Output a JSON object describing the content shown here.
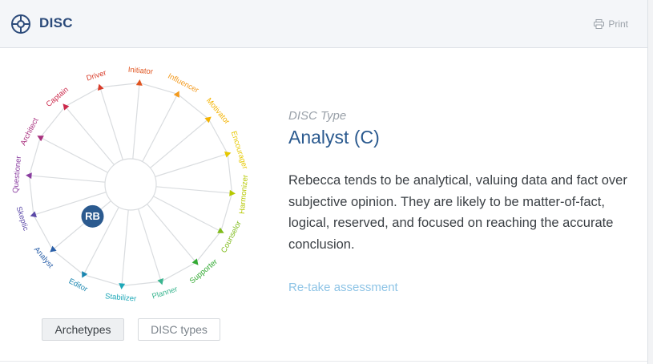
{
  "header": {
    "title": "DISC",
    "print_label": "Print",
    "title_icon": "crosshair-circle-icon",
    "print_icon": "printer-icon",
    "accent": "#2b4a7a"
  },
  "wheel": {
    "avatar_initials": "RB",
    "avatar_color": "#2b5a8f",
    "archetypes": [
      {
        "label": "Initiator",
        "color": "#e0541f"
      },
      {
        "label": "Influencer",
        "color": "#f39a1d"
      },
      {
        "label": "Motivator",
        "color": "#f4b300"
      },
      {
        "label": "Encourager",
        "color": "#e6c800"
      },
      {
        "label": "Harmonizer",
        "color": "#b6c800"
      },
      {
        "label": "Counselor",
        "color": "#7fbb1a"
      },
      {
        "label": "Supporter",
        "color": "#33aa33"
      },
      {
        "label": "Planner",
        "color": "#3ab58f"
      },
      {
        "label": "Stabilizer",
        "color": "#1ea8b8"
      },
      {
        "label": "Editor",
        "color": "#1a86b0"
      },
      {
        "label": "Analyst",
        "color": "#2a5fa8"
      },
      {
        "label": "Skeptic",
        "color": "#5c4aa8"
      },
      {
        "label": "Questioner",
        "color": "#8a3ea0"
      },
      {
        "label": "Architect",
        "color": "#a8307e"
      },
      {
        "label": "Captain",
        "color": "#cc2a4c"
      },
      {
        "label": "Driver",
        "color": "#d83c2a"
      }
    ]
  },
  "result": {
    "caption": "DISC Type",
    "type_name": "Analyst (C)",
    "description": "Rebecca tends to be analytical, valuing data and fact over subjective opinion. They are likely to be matter-of-fact, logical, reserved, and focused on reaching the accurate conclusion.",
    "retake_label": "Re-take assessment"
  },
  "tabs": {
    "archetypes_label": "Archetypes",
    "disc_types_label": "DISC types"
  }
}
